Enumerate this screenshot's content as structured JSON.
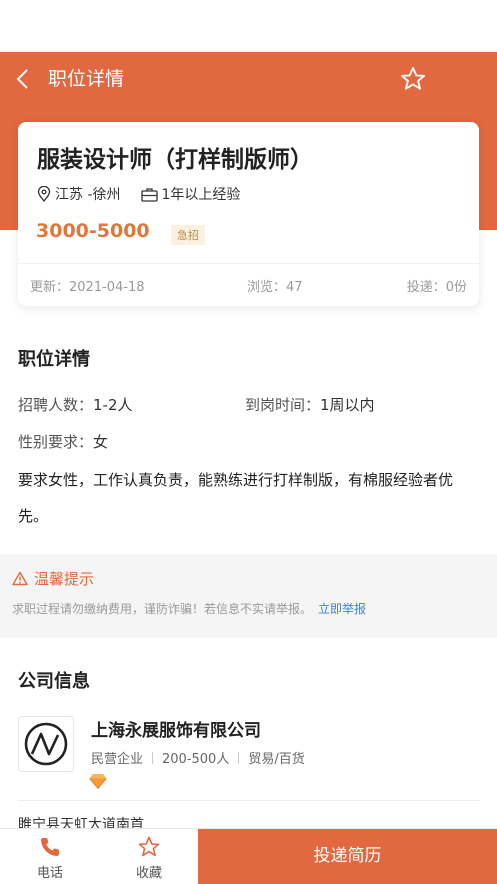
{
  "header": {
    "title": "职位详情"
  },
  "job": {
    "title": "服装设计师（打样制版师）",
    "location": "江苏 -徐州",
    "experience": "1年以上经验",
    "salary": "3000-5000",
    "badge": "急招",
    "updated": "更新：2021-04-18",
    "views": "浏览：47",
    "applications": "投递：0份"
  },
  "details": {
    "section_title": "职位详情",
    "headcount_label": "招聘人数：",
    "headcount_value": "1-2人",
    "arrival_label": "到岗时间：",
    "arrival_value": "1周以内",
    "gender_label": "性别要求：",
    "gender_value": "女",
    "description": "要求女性，工作认真负责，能熟练进行打样制版，有棉服经验者优先。"
  },
  "tips": {
    "title": "温馨提示",
    "text": "求职过程请勿缴纳费用，谨防诈骗！若信息不实请举报。",
    "link": "立即举报"
  },
  "company": {
    "section_title": "公司信息",
    "name": "上海永展服饰有限公司",
    "type": "民营企业",
    "size": "200-500人",
    "industry": "贸易/百货",
    "address": "睢宁县天虹大道南首"
  },
  "bottom": {
    "phone": "电话",
    "favorite": "收藏",
    "apply": "投递简历"
  },
  "colors": {
    "brand": "#E2683F",
    "salary": "#E0783C",
    "link": "#3F7FD8"
  }
}
